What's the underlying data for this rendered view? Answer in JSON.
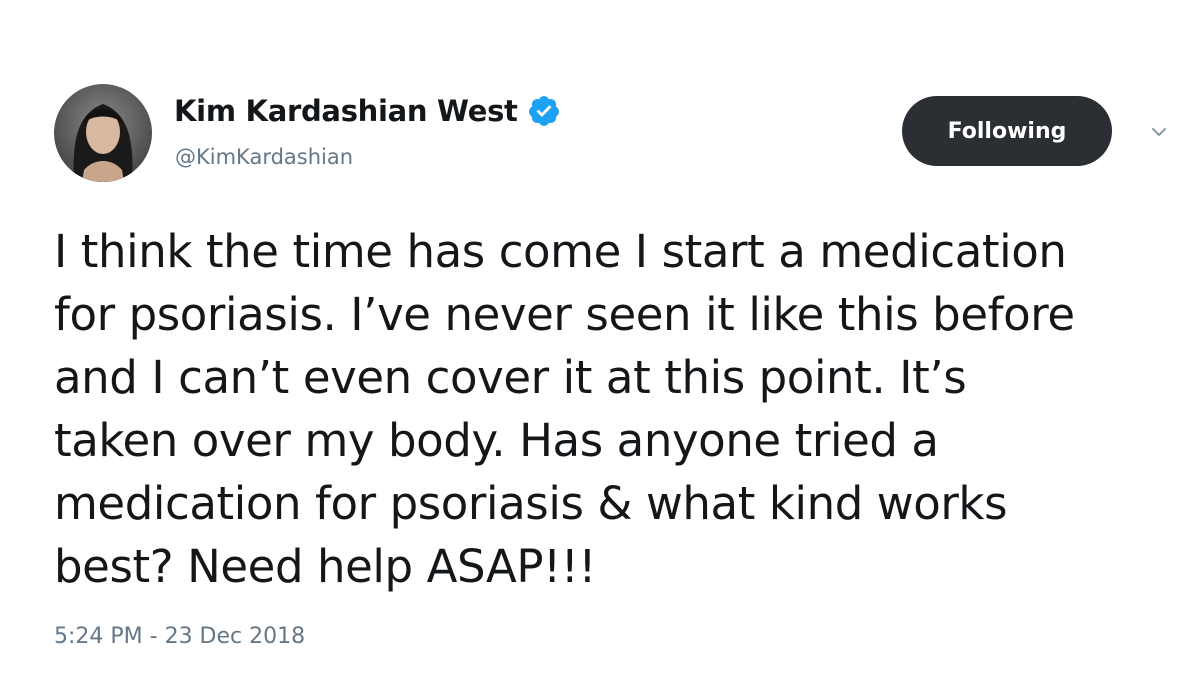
{
  "tweet": {
    "author": {
      "display_name": "Kim Kardashian West",
      "handle": "@KimKardashian",
      "verified": true,
      "avatar_icon": "profile-photo"
    },
    "follow_button": {
      "label": "Following"
    },
    "menu_icon": "chevron-down-icon",
    "text_lines": [
      "I think the time has come I start a medication",
      "for psoriasis. I’ve never seen it like this before",
      "and I can’t even cover it at this point. It’s",
      "taken over my body. Has anyone tried a",
      "medication for psoriasis & what kind works",
      "best? Need help ASAP!!!"
    ],
    "timestamp": "5:24 PM - 23 Dec 2018"
  },
  "colors": {
    "verified_blue": "#1da1f2",
    "button_bg": "#2b2f33",
    "secondary_text": "#657786",
    "primary_text": "#14171a"
  }
}
